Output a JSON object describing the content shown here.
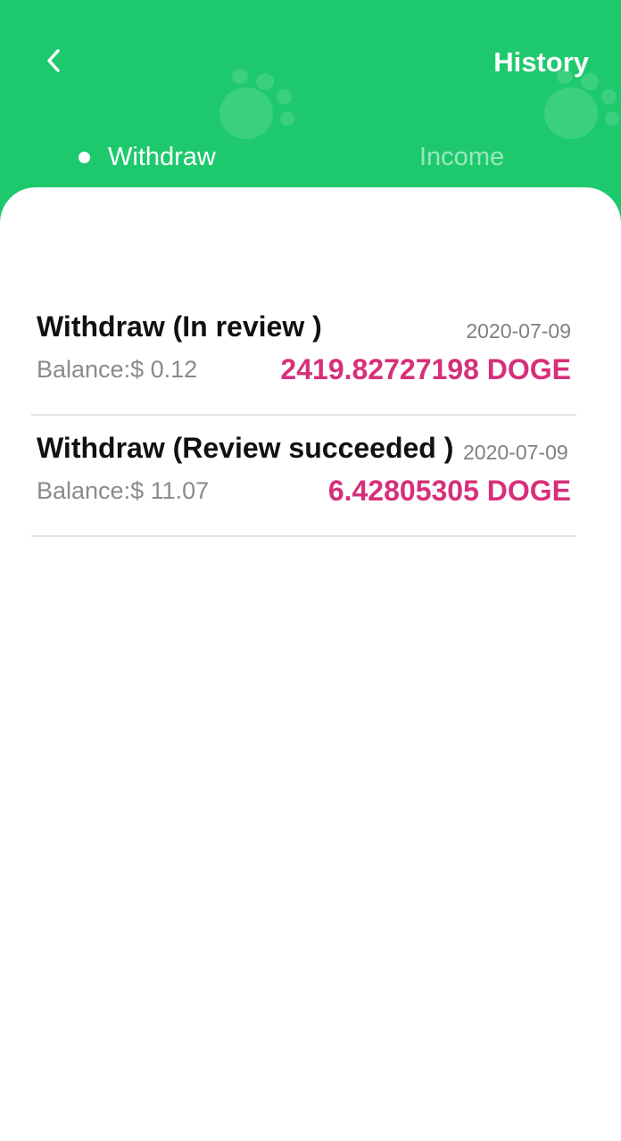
{
  "header": {
    "title": "History",
    "back_icon": "chevron-left-icon",
    "background_color": "#1ec96e"
  },
  "tabs": [
    {
      "label": "Withdraw",
      "active": true
    },
    {
      "label": "Income",
      "active": false
    }
  ],
  "records": [
    {
      "title": "Withdraw (In review )",
      "date": "2020-07-09",
      "balance": "Balance:$ 0.12",
      "amount": "2419.82727198 DOGE"
    },
    {
      "title": "Withdraw (Review succeeded )",
      "date": "2020-07-09",
      "balance": "Balance:$ 11.07",
      "amount": "6.42805305 DOGE"
    }
  ],
  "colors": {
    "accent": "#1ec96e",
    "amount": "#d6307a"
  }
}
